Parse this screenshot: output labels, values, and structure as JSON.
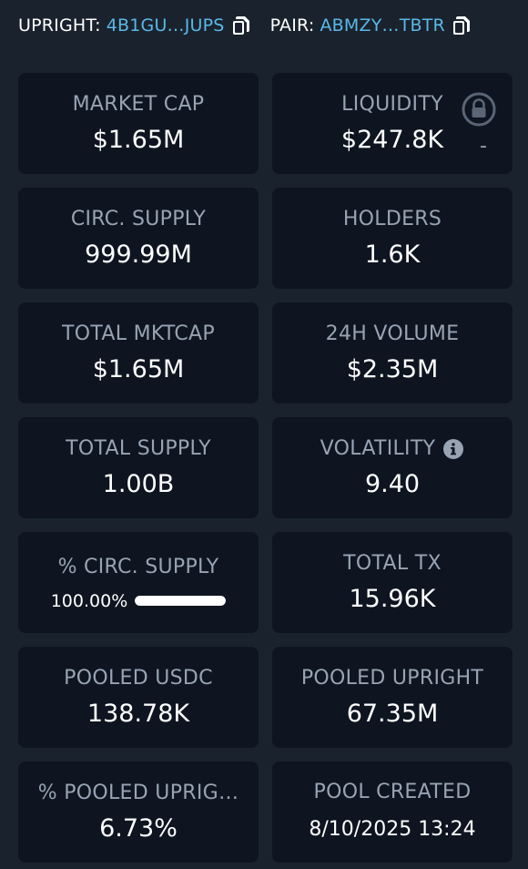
{
  "header": {
    "token_label": "UPRIGHT:",
    "token_address": "4B1GU…JUPS",
    "pair_label": "PAIR:",
    "pair_address": "ABMZY…TBTR"
  },
  "stats": {
    "market_cap": {
      "label": "MARKET CAP",
      "value": "$1.65M"
    },
    "liquidity": {
      "label": "LIQUIDITY",
      "value": "$247.8K",
      "extra": "-"
    },
    "circ_supply": {
      "label": "CIRC. SUPPLY",
      "value": "999.99M"
    },
    "holders": {
      "label": "HOLDERS",
      "value": "1.6K"
    },
    "total_mktcap": {
      "label": "TOTAL MKTCAP",
      "value": "$1.65M"
    },
    "volume_24h": {
      "label": "24H VOLUME",
      "value": "$2.35M"
    },
    "total_supply": {
      "label": "TOTAL SUPPLY",
      "value": "1.00B"
    },
    "volatility": {
      "label": "VOLATILITY",
      "value": "9.40"
    },
    "pct_circ_supply": {
      "label": "% CIRC. SUPPLY",
      "value": "100.00%",
      "progress_pct": 100
    },
    "total_tx": {
      "label": "TOTAL TX",
      "value": "15.96K"
    },
    "pooled_usdc": {
      "label": "POOLED USDC",
      "value": "138.78K"
    },
    "pooled_upright": {
      "label": "POOLED UPRIGHT",
      "value": "67.35M"
    },
    "pct_pooled_upright": {
      "label": "% POOLED UPRIG…",
      "value": "6.73%"
    },
    "pool_created": {
      "label": "POOL CREATED",
      "value": "8/10/2025 13:24"
    }
  },
  "icons": {
    "copy": "copy-icon",
    "lock": "lock-icon",
    "info": "info-icon"
  },
  "colors": {
    "background": "#1a232d",
    "card": "#0e1520",
    "label": "#98a3b3",
    "value": "#ffffff",
    "link": "#5bb8e8"
  }
}
